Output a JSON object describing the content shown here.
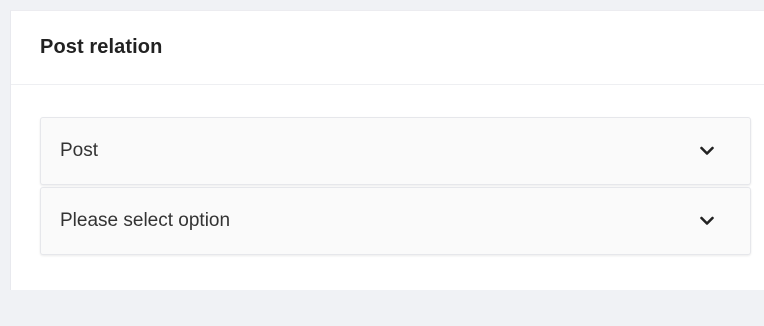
{
  "panel": {
    "title": "Post relation"
  },
  "fields": {
    "post_select": {
      "value": "Post",
      "icon": "chevron-down-icon"
    },
    "option_select": {
      "value": "Please select option",
      "icon": "chevron-down-icon"
    }
  },
  "colors": {
    "background": "#f0f2f5",
    "panel": "#ffffff",
    "select_bg": "#fafafa",
    "text": "#333333",
    "title": "#222222"
  }
}
